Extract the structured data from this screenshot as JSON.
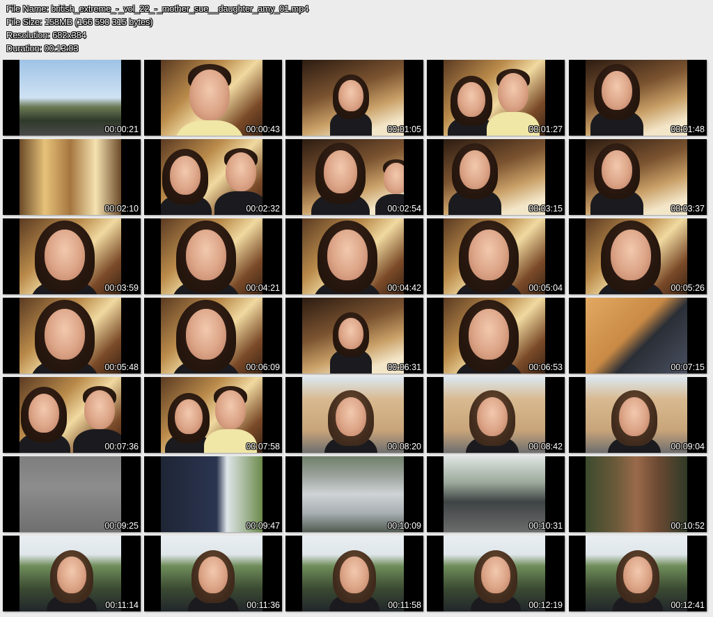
{
  "header": {
    "file_name": "File Name: british_extreme_-_vol_22_-_mother_sue__daughter_amy_01.mp4",
    "file_size": "File Size: 158MB (166 590 315 bytes)",
    "resolution": "Resolution: 682x384",
    "duration": "Duration: 00:13:03"
  },
  "thumbnails": [
    {
      "time": "00:00:21",
      "scene": "road"
    },
    {
      "time": "00:00:43",
      "scene": "man-closeup"
    },
    {
      "time": "00:01:05",
      "scene": "woman-shop"
    },
    {
      "time": "00:01:27",
      "scene": "couple-shop"
    },
    {
      "time": "00:01:48",
      "scene": "woman-profile-shop"
    },
    {
      "time": "00:02:10",
      "scene": "blur-shop"
    },
    {
      "time": "00:02:32",
      "scene": "couple-closeup"
    },
    {
      "time": "00:02:54",
      "scene": "woman-man-shop"
    },
    {
      "time": "00:03:15",
      "scene": "woman-profile-shop"
    },
    {
      "time": "00:03:37",
      "scene": "woman-profile-shop"
    },
    {
      "time": "00:03:59",
      "scene": "woman-closeup"
    },
    {
      "time": "00:04:21",
      "scene": "woman-closeup"
    },
    {
      "time": "00:04:42",
      "scene": "woman-closeup"
    },
    {
      "time": "00:05:04",
      "scene": "woman-closeup"
    },
    {
      "time": "00:05:26",
      "scene": "woman-closeup"
    },
    {
      "time": "00:05:48",
      "scene": "woman-closeup"
    },
    {
      "time": "00:06:09",
      "scene": "woman-closeup"
    },
    {
      "time": "00:06:31",
      "scene": "woman-shop"
    },
    {
      "time": "00:06:53",
      "scene": "woman-closeup"
    },
    {
      "time": "00:07:15",
      "scene": "chair"
    },
    {
      "time": "00:07:36",
      "scene": "couple-closeup"
    },
    {
      "time": "00:07:58",
      "scene": "couple-shop"
    },
    {
      "time": "00:08:20",
      "scene": "woman-outdoor"
    },
    {
      "time": "00:08:42",
      "scene": "woman-outdoor"
    },
    {
      "time": "00:09:04",
      "scene": "woman-outdoor"
    },
    {
      "time": "00:09:25",
      "scene": "asphalt"
    },
    {
      "time": "00:09:47",
      "scene": "van"
    },
    {
      "time": "00:10:09",
      "scene": "car"
    },
    {
      "time": "00:10:31",
      "scene": "cars-parked"
    },
    {
      "time": "00:10:52",
      "scene": "leg"
    },
    {
      "time": "00:11:14",
      "scene": "woman-park"
    },
    {
      "time": "00:11:36",
      "scene": "woman-park"
    },
    {
      "time": "00:11:58",
      "scene": "woman-park"
    },
    {
      "time": "00:12:19",
      "scene": "woman-park"
    },
    {
      "time": "00:12:41",
      "scene": "woman-park"
    }
  ]
}
